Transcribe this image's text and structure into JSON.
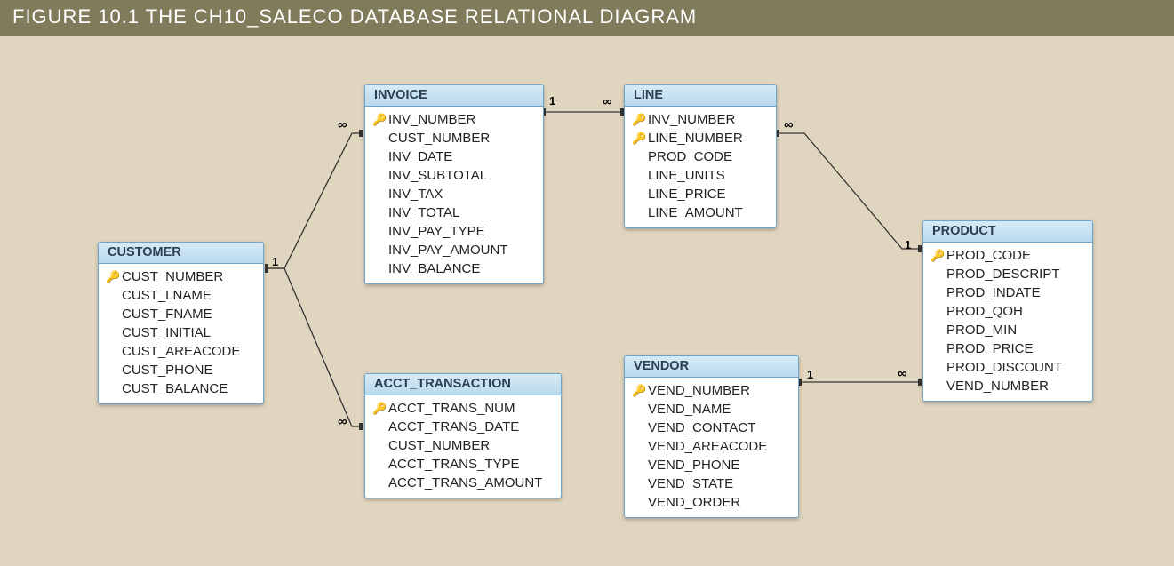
{
  "title": "FIGURE 10.1  THE CH10_SALECO DATABASE RELATIONAL DIAGRAM",
  "tables": {
    "customer": {
      "name": "CUSTOMER",
      "fields": [
        {
          "key": true,
          "name": "CUST_NUMBER"
        },
        {
          "key": false,
          "name": "CUST_LNAME"
        },
        {
          "key": false,
          "name": "CUST_FNAME"
        },
        {
          "key": false,
          "name": "CUST_INITIAL"
        },
        {
          "key": false,
          "name": "CUST_AREACODE"
        },
        {
          "key": false,
          "name": "CUST_PHONE"
        },
        {
          "key": false,
          "name": "CUST_BALANCE"
        }
      ]
    },
    "invoice": {
      "name": "INVOICE",
      "fields": [
        {
          "key": true,
          "name": "INV_NUMBER"
        },
        {
          "key": false,
          "name": "CUST_NUMBER"
        },
        {
          "key": false,
          "name": "INV_DATE"
        },
        {
          "key": false,
          "name": "INV_SUBTOTAL"
        },
        {
          "key": false,
          "name": "INV_TAX"
        },
        {
          "key": false,
          "name": "INV_TOTAL"
        },
        {
          "key": false,
          "name": "INV_PAY_TYPE"
        },
        {
          "key": false,
          "name": "INV_PAY_AMOUNT"
        },
        {
          "key": false,
          "name": "INV_BALANCE"
        }
      ]
    },
    "line": {
      "name": "LINE",
      "fields": [
        {
          "key": true,
          "name": "INV_NUMBER"
        },
        {
          "key": true,
          "name": "LINE_NUMBER"
        },
        {
          "key": false,
          "name": "PROD_CODE"
        },
        {
          "key": false,
          "name": "LINE_UNITS"
        },
        {
          "key": false,
          "name": "LINE_PRICE"
        },
        {
          "key": false,
          "name": "LINE_AMOUNT"
        }
      ]
    },
    "product": {
      "name": "PRODUCT",
      "fields": [
        {
          "key": true,
          "name": "PROD_CODE"
        },
        {
          "key": false,
          "name": "PROD_DESCRIPT"
        },
        {
          "key": false,
          "name": "PROD_INDATE"
        },
        {
          "key": false,
          "name": "PROD_QOH"
        },
        {
          "key": false,
          "name": "PROD_MIN"
        },
        {
          "key": false,
          "name": "PROD_PRICE"
        },
        {
          "key": false,
          "name": "PROD_DISCOUNT"
        },
        {
          "key": false,
          "name": "VEND_NUMBER"
        }
      ]
    },
    "acct": {
      "name": "ACCT_TRANSACTION",
      "fields": [
        {
          "key": true,
          "name": "ACCT_TRANS_NUM"
        },
        {
          "key": false,
          "name": "ACCT_TRANS_DATE"
        },
        {
          "key": false,
          "name": "CUST_NUMBER"
        },
        {
          "key": false,
          "name": "ACCT_TRANS_TYPE"
        },
        {
          "key": false,
          "name": "ACCT_TRANS_AMOUNT"
        }
      ]
    },
    "vendor": {
      "name": "VENDOR",
      "fields": [
        {
          "key": true,
          "name": "VEND_NUMBER"
        },
        {
          "key": false,
          "name": "VEND_NAME"
        },
        {
          "key": false,
          "name": "VEND_CONTACT"
        },
        {
          "key": false,
          "name": "VEND_AREACODE"
        },
        {
          "key": false,
          "name": "VEND_PHONE"
        },
        {
          "key": false,
          "name": "VEND_STATE"
        },
        {
          "key": false,
          "name": "VEND_ORDER"
        }
      ]
    }
  },
  "relationships": [
    {
      "from": "customer",
      "to": "invoice",
      "from_card": "1",
      "to_card": "∞"
    },
    {
      "from": "customer",
      "to": "acct",
      "from_card": "1",
      "to_card": "∞"
    },
    {
      "from": "invoice",
      "to": "line",
      "from_card": "1",
      "to_card": "∞"
    },
    {
      "from": "line",
      "to": "product",
      "from_card": "∞",
      "to_card": "1"
    },
    {
      "from": "vendor",
      "to": "product",
      "from_card": "1",
      "to_card": "∞"
    }
  ],
  "key_glyph": "🔑",
  "infinity_glyph": "∞",
  "one_glyph": "1"
}
